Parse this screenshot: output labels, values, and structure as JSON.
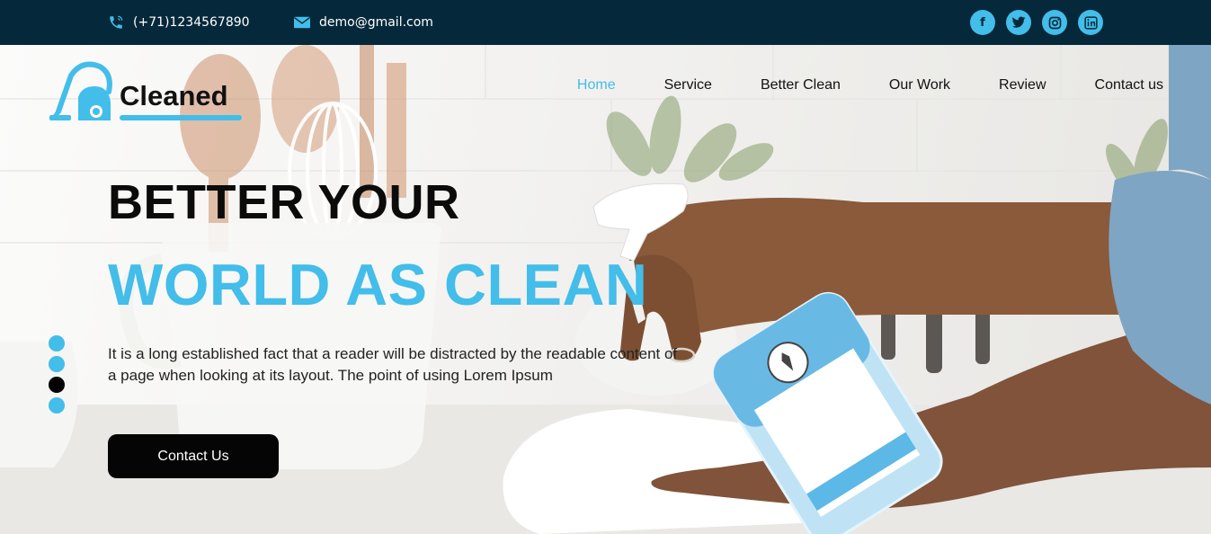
{
  "colors": {
    "topbar": "#05293b",
    "accent": "#43bde9",
    "dark": "#050505"
  },
  "topbar": {
    "phone": "(+71)1234567890",
    "email": "demo@gmail.com",
    "socials": [
      {
        "name": "facebook-icon",
        "glyph": "f"
      },
      {
        "name": "twitter-icon",
        "glyph": "t"
      },
      {
        "name": "instagram-icon",
        "glyph": "◎"
      },
      {
        "name": "linkedin-icon",
        "glyph": "in"
      }
    ]
  },
  "logo": {
    "text": "Cleaned"
  },
  "nav": {
    "items": [
      {
        "label": "Home",
        "active": true
      },
      {
        "label": "Service"
      },
      {
        "label": "Better Clean"
      },
      {
        "label": "Our Work"
      },
      {
        "label": "Review"
      },
      {
        "label": "Contact us"
      }
    ]
  },
  "hero": {
    "title_line1": "BETTER YOUR",
    "title_line2": "WORLD AS CLEAN",
    "paragraph": "It is a long established fact that a reader will be distracted by the readable content of a page when looking at its layout. The point of using Lorem Ipsum",
    "cta_label": "Contact Us",
    "slider": {
      "count": 4,
      "active_index": 2
    }
  }
}
